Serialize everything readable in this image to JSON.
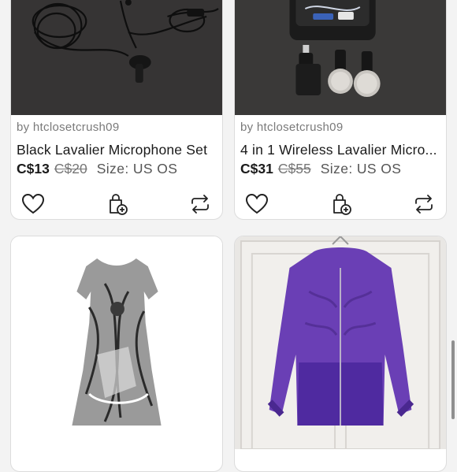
{
  "listings": [
    {
      "seller": "by htclosetcrush09",
      "title": "Black Lavalier Microphone Set",
      "price": "C$13",
      "original_price": "C$20",
      "size": "Size: US OS",
      "image": "black lavalier microphone cables"
    },
    {
      "seller": "by htclosetcrush09",
      "title": "4 in 1 Wireless Lavalier Micro...",
      "price": "C$31",
      "original_price": "C$55",
      "size": "Size: US OS",
      "image": "wireless microphones with fluffy windscreens in case"
    },
    {
      "image": "black and white printed dress"
    },
    {
      "image": "purple zip-up jacket hanging on door"
    }
  ],
  "icons": {
    "like": "heart-icon",
    "bag": "add-to-bag-icon",
    "share": "share-icon"
  },
  "colors": {
    "text": "#1a1a1a",
    "muted": "#7a7a7a",
    "purple": "#6a3fb5"
  }
}
